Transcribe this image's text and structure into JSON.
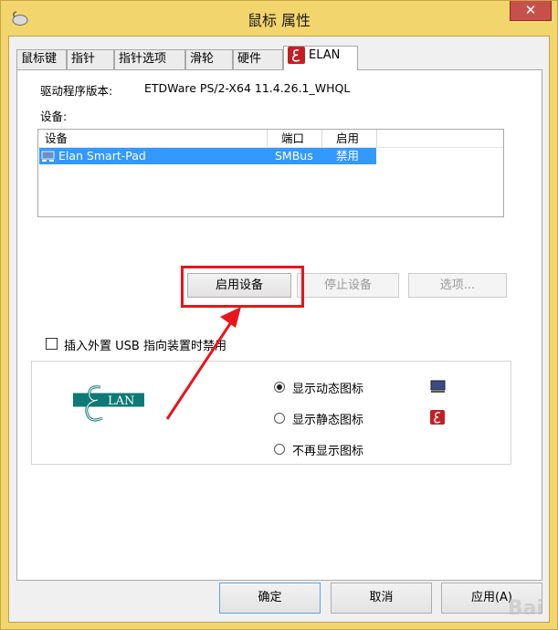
{
  "window": {
    "title": "鼠标 属性",
    "close_glyph": "✕"
  },
  "tabs": [
    {
      "label": "鼠标键"
    },
    {
      "label": "指针"
    },
    {
      "label": "指针选项"
    },
    {
      "label": "滑轮"
    },
    {
      "label": "硬件"
    },
    {
      "label": "ELAN",
      "active": true
    }
  ],
  "driver": {
    "label": "驱动程序版本:",
    "value": "ETDWare PS/2-X64 11.4.26.1_WHQL"
  },
  "devices": {
    "label": "设备:",
    "columns": [
      "设备",
      "端口",
      "启用"
    ],
    "rows": [
      {
        "device": "Elan Smart-Pad",
        "port": "SMBus",
        "enabled": "禁用"
      }
    ]
  },
  "buttons": {
    "enable": "启用设备",
    "disable": "停止设备",
    "options": "选项..."
  },
  "usb_checkbox": {
    "label": "插入外置 USB 指向装置时禁用",
    "checked": false
  },
  "tray_icon": {
    "options": [
      {
        "label": "显示动态图标",
        "selected": true,
        "icon": "monitor-icon"
      },
      {
        "label": "显示静态图标",
        "selected": false,
        "icon": "elan-icon"
      },
      {
        "label": "不再显示图标",
        "selected": false,
        "icon": ""
      }
    ]
  },
  "logo": {
    "text": "LAN"
  },
  "footer": {
    "ok": "确定",
    "cancel": "取消",
    "apply": "应用(A)"
  },
  "watermark": "Bai",
  "colors": {
    "selection": "#3399ff",
    "highlight_box": "#e8151b",
    "title_bar": "#f3d56d",
    "elan_red": "#c21f24"
  }
}
